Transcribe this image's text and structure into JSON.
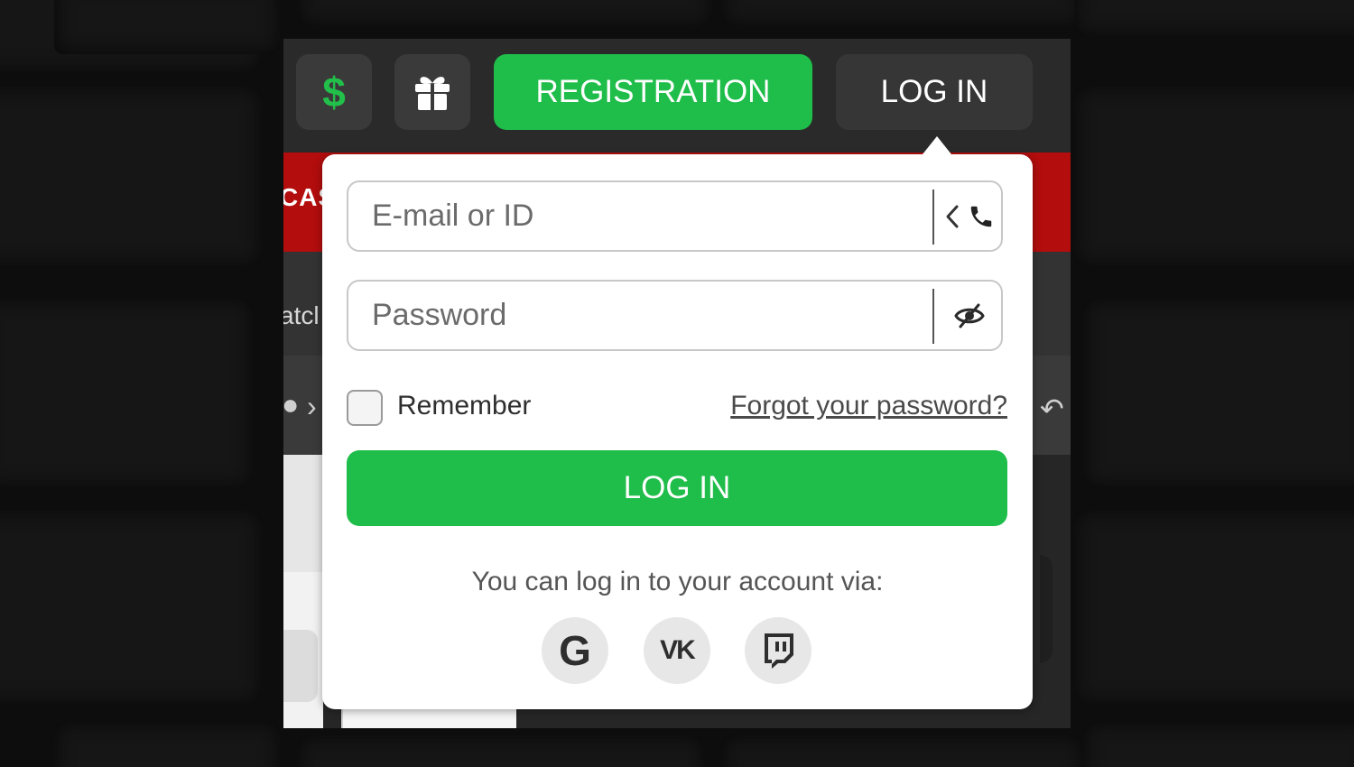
{
  "header": {
    "deposit_icon": "dollar-icon",
    "deposit_symbol": "$",
    "bonus_icon": "gift-icon",
    "registration_label": "REGISTRATION",
    "login_label": "LOG IN"
  },
  "background_page": {
    "nav_fragment": "CAS",
    "tab_fragment": "atcl"
  },
  "login_form": {
    "login_field": {
      "placeholder": "E-mail or ID",
      "value": "",
      "switch_icon": "chevron-left-icon",
      "phone_icon": "phone-icon"
    },
    "password_field": {
      "placeholder": "Password",
      "value": "",
      "toggle_icon": "eye-slash-icon"
    },
    "remember_label": "Remember",
    "remember_checked": false,
    "forgot_password_label": "Forgot your password?",
    "submit_label": "LOG IN",
    "social_caption": "You can log in to your account via:",
    "social_logins": [
      {
        "name": "google",
        "icon": "google-icon",
        "glyph": "G"
      },
      {
        "name": "vk",
        "icon": "vk-icon",
        "glyph": "VK"
      },
      {
        "name": "twitch",
        "icon": "twitch-icon"
      }
    ]
  },
  "colors": {
    "accent_green": "#1fbd4a",
    "dollar_green": "#22c04a",
    "brand_red": "#b30d0d",
    "dark_bg": "#262626"
  }
}
